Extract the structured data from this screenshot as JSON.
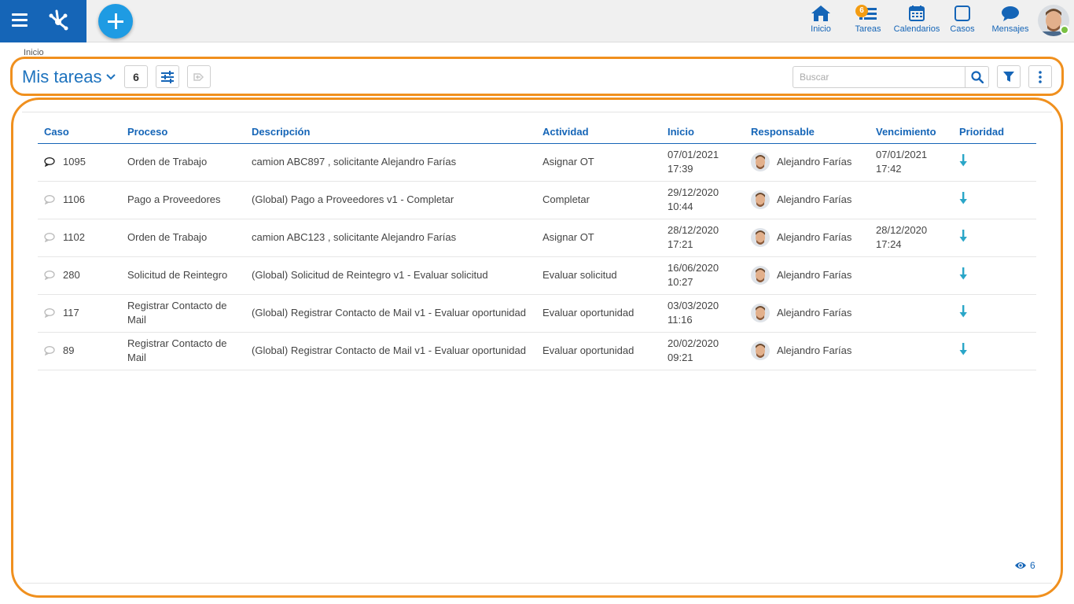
{
  "colors": {
    "brand": "#1565b7",
    "accent": "#1e9be3",
    "highlight": "#f0901e",
    "danger": "#e0475c",
    "badge": "#f39c12"
  },
  "topbar": {
    "nav": [
      {
        "label": "Inicio",
        "icon": "home-icon"
      },
      {
        "label": "Tareas",
        "icon": "tasks-icon",
        "badge": "6"
      },
      {
        "label": "Calendarios",
        "icon": "calendar-icon"
      },
      {
        "label": "Casos",
        "icon": "cases-icon"
      },
      {
        "label": "Mensajes",
        "icon": "messages-icon"
      }
    ]
  },
  "breadcrumb": "Inicio",
  "toolbar": {
    "title": "Mis tareas",
    "count": "6",
    "search_placeholder": "Buscar"
  },
  "table": {
    "columns": [
      "Caso",
      "Proceso",
      "Descripción",
      "Actividad",
      "Inicio",
      "Responsable",
      "Vencimiento",
      "Prioridad"
    ],
    "rows": [
      {
        "caso": "1095",
        "proceso": "Orden de Trabajo",
        "descripcion": "camion ABC897 , solicitante Alejandro Farías",
        "actividad": "Asignar OT",
        "inicio_fecha": "07/01/2021",
        "inicio_hora": "17:39",
        "responsable": "Alejandro Farías",
        "venc_fecha": "07/01/2021",
        "venc_hora": "17:42",
        "comment_active": true,
        "priority": "low"
      },
      {
        "caso": "1106",
        "proceso": "Pago a Proveedores",
        "descripcion": "(Global) Pago a Proveedores v1 - Completar",
        "actividad": "Completar",
        "inicio_fecha": "29/12/2020",
        "inicio_hora": "10:44",
        "responsable": "Alejandro Farías",
        "venc_fecha": "",
        "venc_hora": "",
        "comment_active": false,
        "priority": "low"
      },
      {
        "caso": "1102",
        "proceso": "Orden de Trabajo",
        "descripcion": "camion ABC123 , solicitante Alejandro Farías",
        "actividad": "Asignar OT",
        "inicio_fecha": "28/12/2020",
        "inicio_hora": "17:21",
        "responsable": "Alejandro Farías",
        "venc_fecha": "28/12/2020",
        "venc_hora": "17:24",
        "comment_active": false,
        "priority": "low"
      },
      {
        "caso": "280",
        "proceso": "Solicitud de Reintegro",
        "descripcion": "(Global) Solicitud de Reintegro v1 - Evaluar solicitud",
        "actividad": "Evaluar solicitud",
        "inicio_fecha": "16/06/2020",
        "inicio_hora": "10:27",
        "responsable": "Alejandro Farías",
        "venc_fecha": "",
        "venc_hora": "",
        "comment_active": false,
        "priority": "low"
      },
      {
        "caso": "117",
        "proceso": "Registrar Contacto de Mail",
        "descripcion": "(Global) Registrar Contacto de Mail v1 - Evaluar oportunidad",
        "actividad": "Evaluar oportunidad",
        "inicio_fecha": "03/03/2020",
        "inicio_hora": "11:16",
        "responsable": "Alejandro Farías",
        "venc_fecha": "",
        "venc_hora": "",
        "comment_active": false,
        "priority": "low"
      },
      {
        "caso": "89",
        "proceso": "Registrar Contacto de Mail",
        "descripcion": "(Global) Registrar Contacto de Mail v1 - Evaluar oportunidad",
        "actividad": "Evaluar oportunidad",
        "inicio_fecha": "20/02/2020",
        "inicio_hora": "09:21",
        "responsable": "Alejandro Farías",
        "venc_fecha": "",
        "venc_hora": "",
        "comment_active": false,
        "priority": "low"
      }
    ]
  },
  "footer": {
    "visible_count": "6"
  }
}
